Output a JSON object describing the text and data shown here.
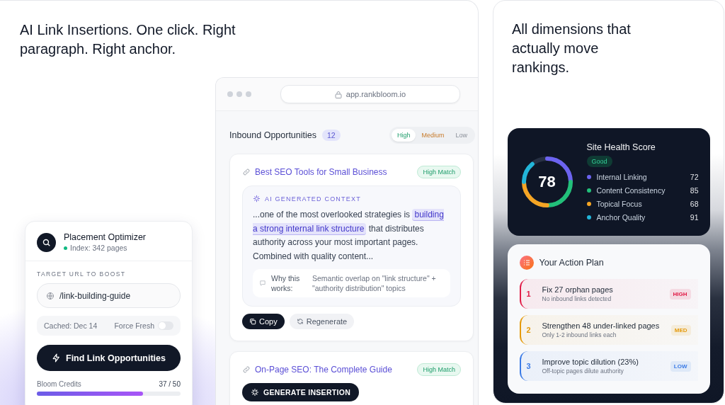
{
  "left_panel": {
    "headline": "AI Link Insertions. One click. Right paragraph. Right anchor."
  },
  "browser": {
    "url": "app.rankbloom.io",
    "section_title": "Inbound Opportunities",
    "count": "12",
    "filters": [
      {
        "label": "High",
        "selected": true
      },
      {
        "label": "Medium",
        "selected": false
      },
      {
        "label": "Low",
        "selected": false
      }
    ],
    "opportunities": [
      {
        "kind": "expanded",
        "title": "Best SEO Tools for Small Business",
        "match": "High Match",
        "context_label": "AI GENERATED CONTEXT",
        "context_before": "...one of the most overlooked strategies is",
        "anchor": "building a strong internal link structure",
        "context_after": "that distributes authority across your most important pages. Combined with quality content...",
        "why_label": "Why this works:",
        "why_text": "Semantic overlap on \"link structure\" + \"authority distribution\" topics",
        "actions": [
          {
            "label": "Copy",
            "kind": "primary"
          },
          {
            "label": "Regenerate",
            "kind": "secondary"
          }
        ]
      },
      {
        "kind": "collapsed",
        "title": "On-Page SEO: The Complete Guide",
        "match": "High Match",
        "action": "GENERATE INSERTION"
      }
    ]
  },
  "optimizer": {
    "title": "Placement Optimizer",
    "status": "Index: 342 pages",
    "target_label": "TARGET URL TO BOOST",
    "target_value": "/link-building-guide",
    "cached": "Cached: Dec 14",
    "force_fresh": {
      "label": "Force Fresh",
      "on": false
    },
    "button": "Find Link Opportunities",
    "credits_label": "Bloom Credits",
    "credits_value": "37 / 50",
    "level": 0.74
  },
  "right_panel": {
    "headline": "All dimensions that actually move rankings."
  },
  "health": {
    "title": "Site Health Score",
    "score": "78",
    "status": "Good",
    "metrics": [
      {
        "name": "Internal Linking",
        "value": "72",
        "color": "#6c63f0"
      },
      {
        "name": "Content Consistency",
        "value": "85",
        "color": "#22c07a"
      },
      {
        "name": "Topical Focus",
        "value": "68",
        "color": "#f5a524"
      },
      {
        "name": "Anchor Quality",
        "value": "91",
        "color": "#22b5d8"
      }
    ]
  },
  "plan": {
    "title": "Your Action Plan",
    "items": [
      {
        "number": "1",
        "title": "Fix 27 orphan pages",
        "subtitle": "No inbound links detected",
        "priority": "HIGH",
        "color": "#e11d48"
      },
      {
        "number": "2",
        "title": "Strengthen 48 under-linked pages",
        "subtitle": "Only 1-2 inbound links each",
        "priority": "MED",
        "color": "#e59a0b"
      },
      {
        "number": "3",
        "title": "Improve topic dilution (23%)",
        "subtitle": "Off-topic pages dilute authority",
        "priority": "LOW",
        "color": "#3b7be6"
      }
    ]
  }
}
